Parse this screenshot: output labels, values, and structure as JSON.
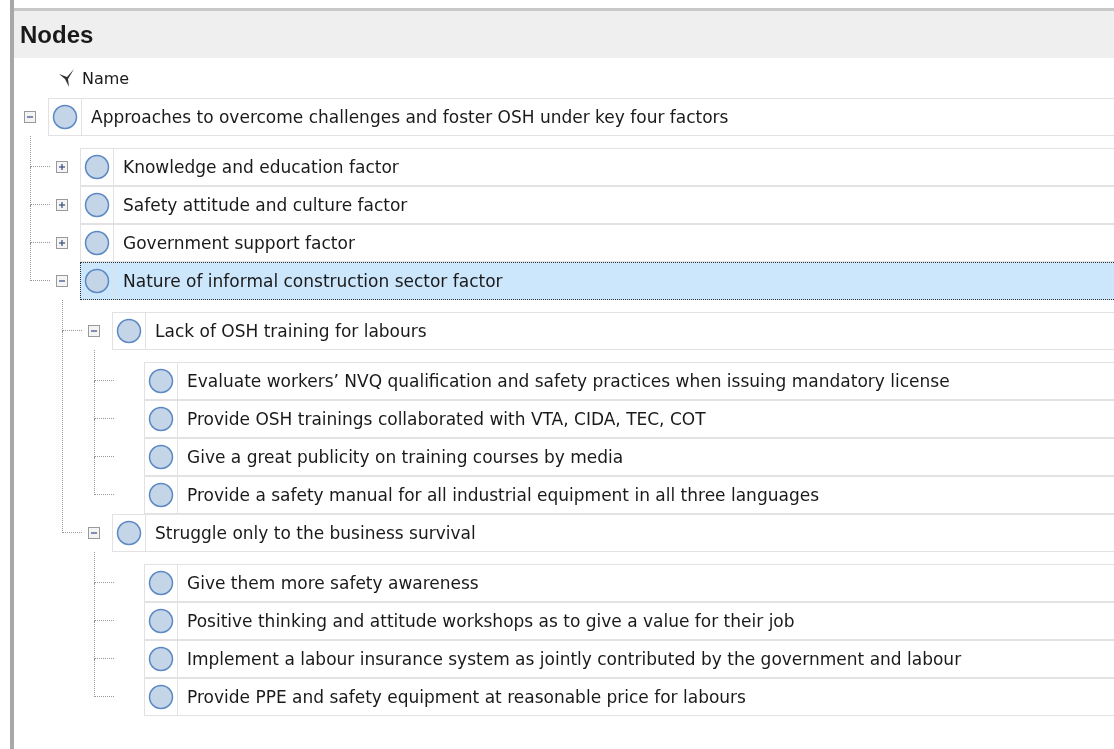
{
  "panel": {
    "title": "Nodes"
  },
  "name_column": {
    "label": "Name"
  },
  "nodes": [
    {
      "label": "Approaches to overcome challenges and foster OSH under key four factors",
      "expanded": true,
      "selected": false,
      "children": [
        {
          "label": "Knowledge and education factor",
          "expanded": false,
          "selected": false
        },
        {
          "label": "Safety attitude and culture factor",
          "expanded": false,
          "selected": false
        },
        {
          "label": "Government support factor",
          "expanded": false,
          "selected": false
        },
        {
          "label": "Nature of informal construction sector factor",
          "expanded": true,
          "selected": true,
          "children": [
            {
              "label": "Lack of OSH training for labours",
              "expanded": true,
              "selected": false,
              "children": [
                {
                  "label": "Evaluate workers’ NVQ qualification and safety practices when issuing mandatory license",
                  "selected": false
                },
                {
                  "label": "Provide OSH trainings collaborated with VTA, CIDA, TEC, COT",
                  "selected": false
                },
                {
                  "label": "Give a great publicity on training  courses by media",
                  "selected": false
                },
                {
                  "label": "Provide a safety manual for all industrial equipment in all three languages",
                  "selected": false
                }
              ]
            },
            {
              "label": "Struggle only to the business survival",
              "expanded": true,
              "selected": false,
              "children": [
                {
                  "label": "Give them more safety awareness",
                  "selected": false
                },
                {
                  "label": "Positive thinking and attitude workshops as to give a value for their job",
                  "selected": false
                },
                {
                  "label": "Implement a labour insurance system as jointly contributed by the government and labour",
                  "selected": false
                },
                {
                  "label": "Provide PPE and safety  equipment at reasonable price for labours",
                  "selected": false
                }
              ]
            }
          ]
        }
      ]
    }
  ]
}
